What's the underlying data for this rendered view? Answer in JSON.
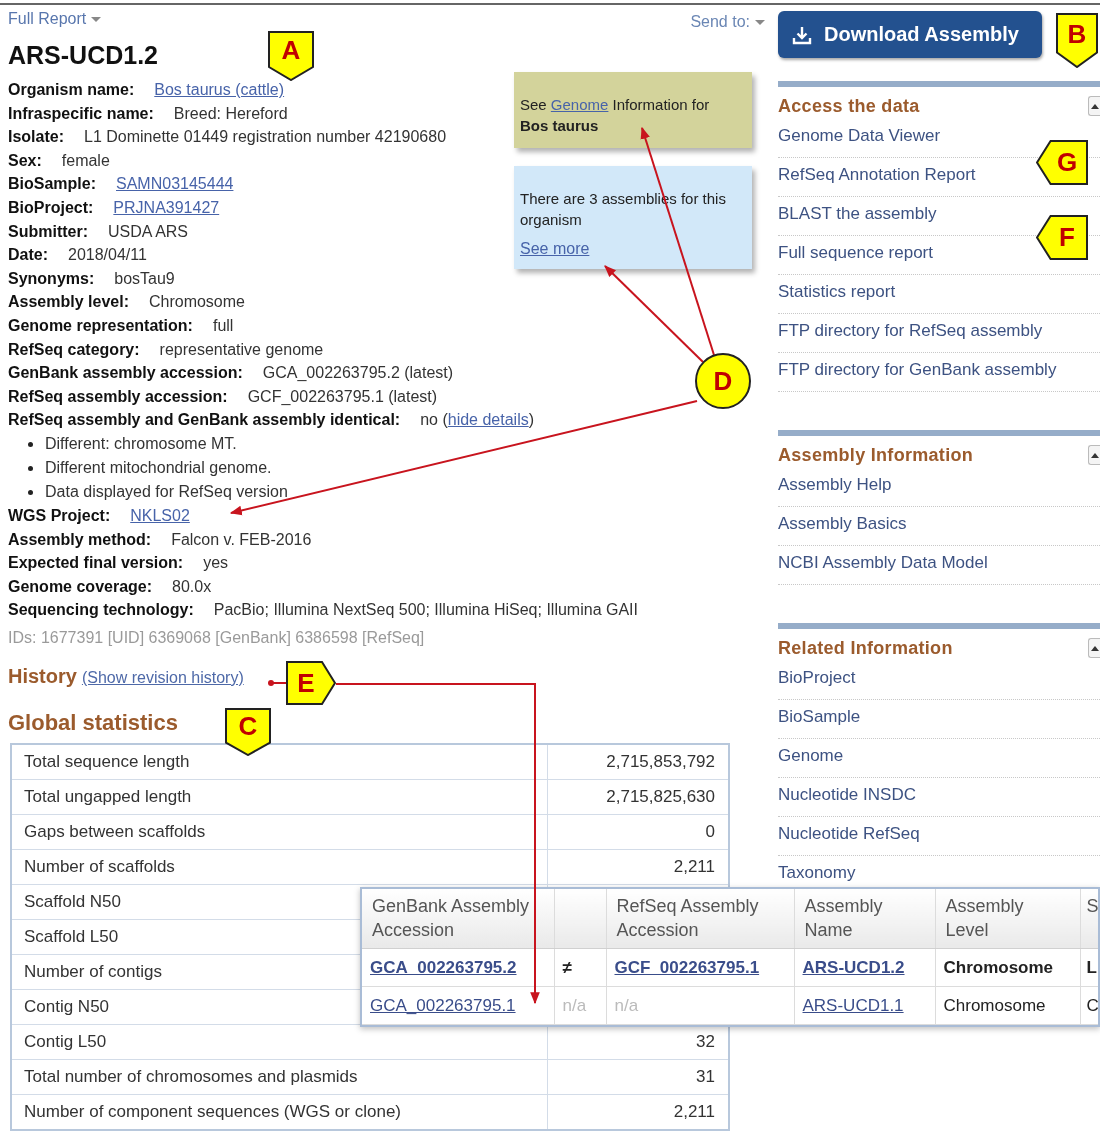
{
  "header": {
    "report_menu": "Full Report",
    "send_to": "Send to:"
  },
  "title": "ARS-UCD1.2",
  "notices": [
    {
      "kind": "genome-info",
      "before": "See",
      "link": "Genome",
      "after": "Information for",
      "organism": "Bos taurus"
    },
    {
      "kind": "assemblies",
      "text": "There are 3 assemblies for this organism",
      "link": "See more"
    }
  ],
  "fields": [
    {
      "kind": "field",
      "label": "Organism name:",
      "value": "Bos taurus (cattle)",
      "link": true
    },
    {
      "kind": "field",
      "label": "Infraspecific name:",
      "value": "Breed: Hereford",
      "link": false
    },
    {
      "kind": "field",
      "label": "Isolate:",
      "value": "L1 Dominette 01449 registration number 42190680",
      "link": false
    },
    {
      "kind": "field",
      "label": "Sex:",
      "value": "female",
      "link": false
    },
    {
      "kind": "field",
      "label": "BioSample:",
      "value": "SAMN03145444",
      "link": true
    },
    {
      "kind": "field",
      "label": "BioProject:",
      "value": "PRJNA391427",
      "link": true
    },
    {
      "kind": "field",
      "label": "Submitter:",
      "value": "USDA ARS",
      "link": false
    },
    {
      "kind": "field",
      "label": "Date:",
      "value": "2018/04/11",
      "link": false
    },
    {
      "kind": "field",
      "label": "Synonyms:",
      "value": "bosTau9",
      "link": false
    },
    {
      "kind": "field",
      "label": "Assembly level:",
      "value": "Chromosome",
      "link": false
    },
    {
      "kind": "field",
      "label": "Genome representation:",
      "value": "full",
      "link": false
    },
    {
      "kind": "field",
      "label": "RefSeq category:",
      "value": "representative genome",
      "link": false
    },
    {
      "kind": "field",
      "label": "GenBank assembly accession:",
      "value": "GCA_002263795.2 (latest)",
      "link": false
    },
    {
      "kind": "field",
      "label": "RefSeq assembly accession:",
      "value": "GCF_002263795.1 (latest)",
      "link": false
    },
    {
      "kind": "field",
      "label": "RefSeq assembly and GenBank assembly identical:",
      "parts": [
        {
          "text": "no (",
          "link": false
        },
        {
          "text": "hide details",
          "link": true
        },
        {
          "text": ")",
          "link": false
        }
      ]
    },
    {
      "kind": "bullets",
      "items": [
        "Different: chromosome MT.",
        "Different mitochondrial genome.",
        "Data displayed for RefSeq version"
      ]
    },
    {
      "kind": "field",
      "label": "WGS Project:",
      "value": "NKLS02",
      "link": true
    },
    {
      "kind": "field",
      "label": "Assembly method:",
      "value": "Falcon v. FEB-2016",
      "link": false
    },
    {
      "kind": "field",
      "label": "Expected final version:",
      "value": "yes",
      "link": false
    },
    {
      "kind": "field",
      "label": "Genome coverage:",
      "value": "80.0x",
      "link": false
    },
    {
      "kind": "field",
      "label": "Sequencing technology:",
      "value": "PacBio; Illumina NextSeq 500; Illumina HiSeq; Illumina GAII",
      "link": false
    }
  ],
  "ids": "IDs: 1677391 [UID] 6369068 [GenBank] 6386598 [RefSeq]",
  "history": {
    "title": "History",
    "link": "(Show revision history)"
  },
  "global_statistics": {
    "title": "Global statistics",
    "rows": [
      {
        "label": "Total sequence length",
        "value": "2,715,853,792"
      },
      {
        "label": "Total ungapped length",
        "value": "2,715,825,630"
      },
      {
        "label": "Gaps between scaffolds",
        "value": "0"
      },
      {
        "label": "Number of scaffolds",
        "value": "2,211"
      },
      {
        "label": "Scaffold N50"
      },
      {
        "label": "Scaffold L50"
      },
      {
        "label": "Number of contigs"
      },
      {
        "label": "Contig N50"
      },
      {
        "label": "Contig L50",
        "value": "32"
      },
      {
        "label": "Total number of chromosomes and plasmids",
        "value": "31"
      },
      {
        "label": "Number of component sequences (WGS or clone)",
        "value": "2,211"
      }
    ]
  },
  "download_button": "Download Assembly",
  "sidebar": [
    {
      "title": "Access the data",
      "expanded": true,
      "items": [
        "Genome Data Viewer",
        "RefSeq Annotation Report",
        "BLAST the assembly",
        "Full sequence report",
        "Statistics report",
        "FTP directory for RefSeq assembly",
        "FTP directory for GenBank assembly"
      ]
    },
    {
      "title": "Assembly Information",
      "expanded": true,
      "items": [
        "Assembly Help",
        "Assembly Basics",
        "NCBI Assembly Data Model"
      ]
    },
    {
      "title": "Related Information",
      "expanded": true,
      "items": [
        "BioProject",
        "BioSample",
        "Genome",
        "Nucleotide INSDC",
        "Nucleotide RefSeq",
        "Taxonomy"
      ]
    }
  ],
  "revision_table": {
    "columns": {
      "genbank": "GenBank Assembly Accession",
      "refseq": "RefSeq Assembly Accession",
      "name": "Assembly Name",
      "assembly_level": "Assembly Level",
      "column_6": "S"
    },
    "rows": [
      {
        "current": true,
        "genbank": "GCA_002263795.2",
        "relation": "≠",
        "refseq": "GCF_002263795.1",
        "refseq_link": true,
        "name": "ARS-UCD1.2",
        "assembly_level": "Chromosome",
        "column_6": "L"
      },
      {
        "current": false,
        "genbank": "GCA_002263795.1",
        "relation": "n/a",
        "refseq": "n/a",
        "refseq_link": false,
        "name": "ARS-UCD1.1",
        "assembly_level": "Chromosome",
        "column_6": "C"
      }
    ]
  },
  "callouts": [
    {
      "label": "A",
      "kind": "down"
    },
    {
      "label": "B",
      "kind": "down"
    },
    {
      "label": "G",
      "kind": "left"
    },
    {
      "label": "F",
      "kind": "left"
    },
    {
      "label": "D",
      "kind": "circle"
    },
    {
      "label": "E",
      "kind": "right"
    },
    {
      "label": "C",
      "kind": "down"
    }
  ]
}
